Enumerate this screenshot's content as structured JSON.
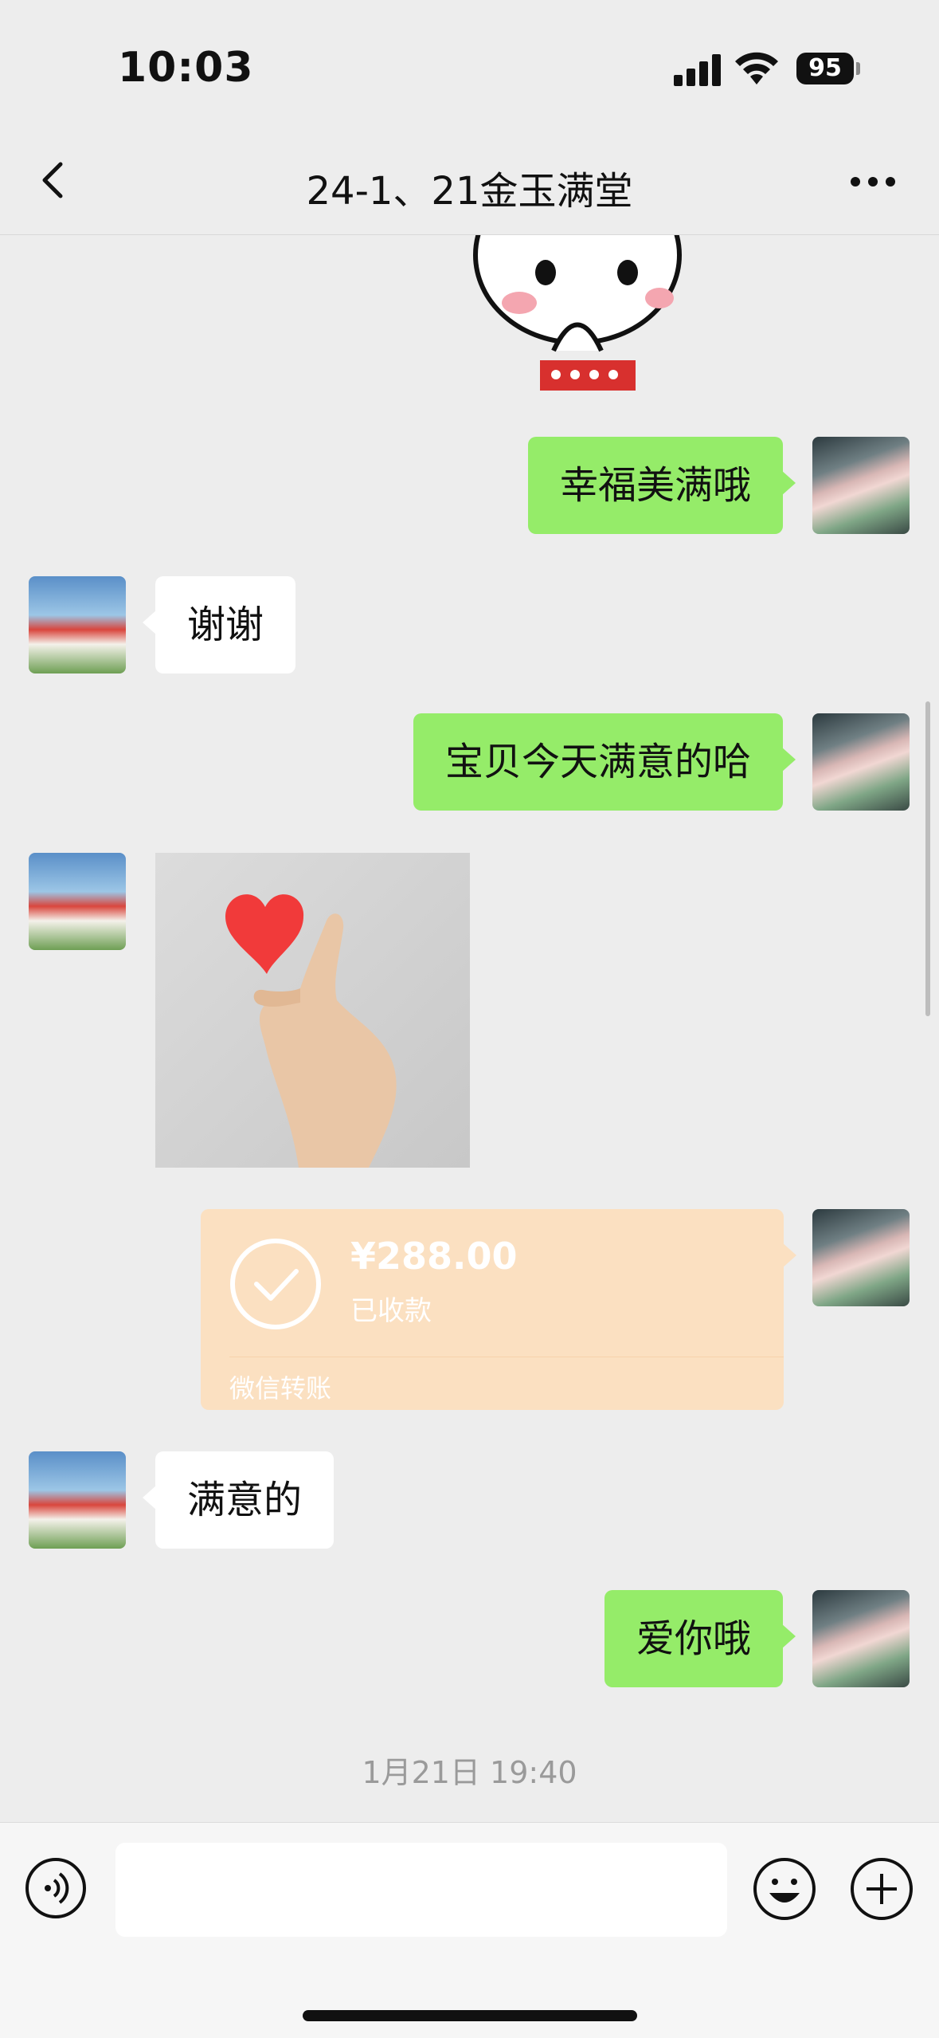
{
  "status_bar": {
    "time": "10:03",
    "battery": "95"
  },
  "nav": {
    "title": "24-1、21金玉满堂",
    "back_icon": "chevron-left-icon",
    "more_icon": "more-dots-icon"
  },
  "messages": [
    {
      "side": "me",
      "type": "text",
      "text": "幸福美满哦"
    },
    {
      "side": "other",
      "type": "text",
      "text": "谢谢"
    },
    {
      "side": "me",
      "type": "text",
      "text": "宝贝今天满意的哈"
    },
    {
      "side": "other",
      "type": "image",
      "content": "heart finger gesture photo"
    },
    {
      "side": "me",
      "type": "transfer",
      "amount": "¥288.00",
      "status": "已收款",
      "label": "微信转账"
    },
    {
      "side": "other",
      "type": "text",
      "text": "满意的"
    },
    {
      "side": "me",
      "type": "text",
      "text": "爱你哦"
    }
  ],
  "timestamp": "1月21日 19:40",
  "input_bar": {
    "voice_icon": "voice-icon",
    "input_value": "",
    "emoji_icon": "emoji-icon",
    "plus_icon": "plus-icon"
  },
  "colors": {
    "my_bubble": "#95ec69",
    "other_bubble": "#ffffff",
    "transfer": "#fbe0c1",
    "background": "#ededed"
  }
}
